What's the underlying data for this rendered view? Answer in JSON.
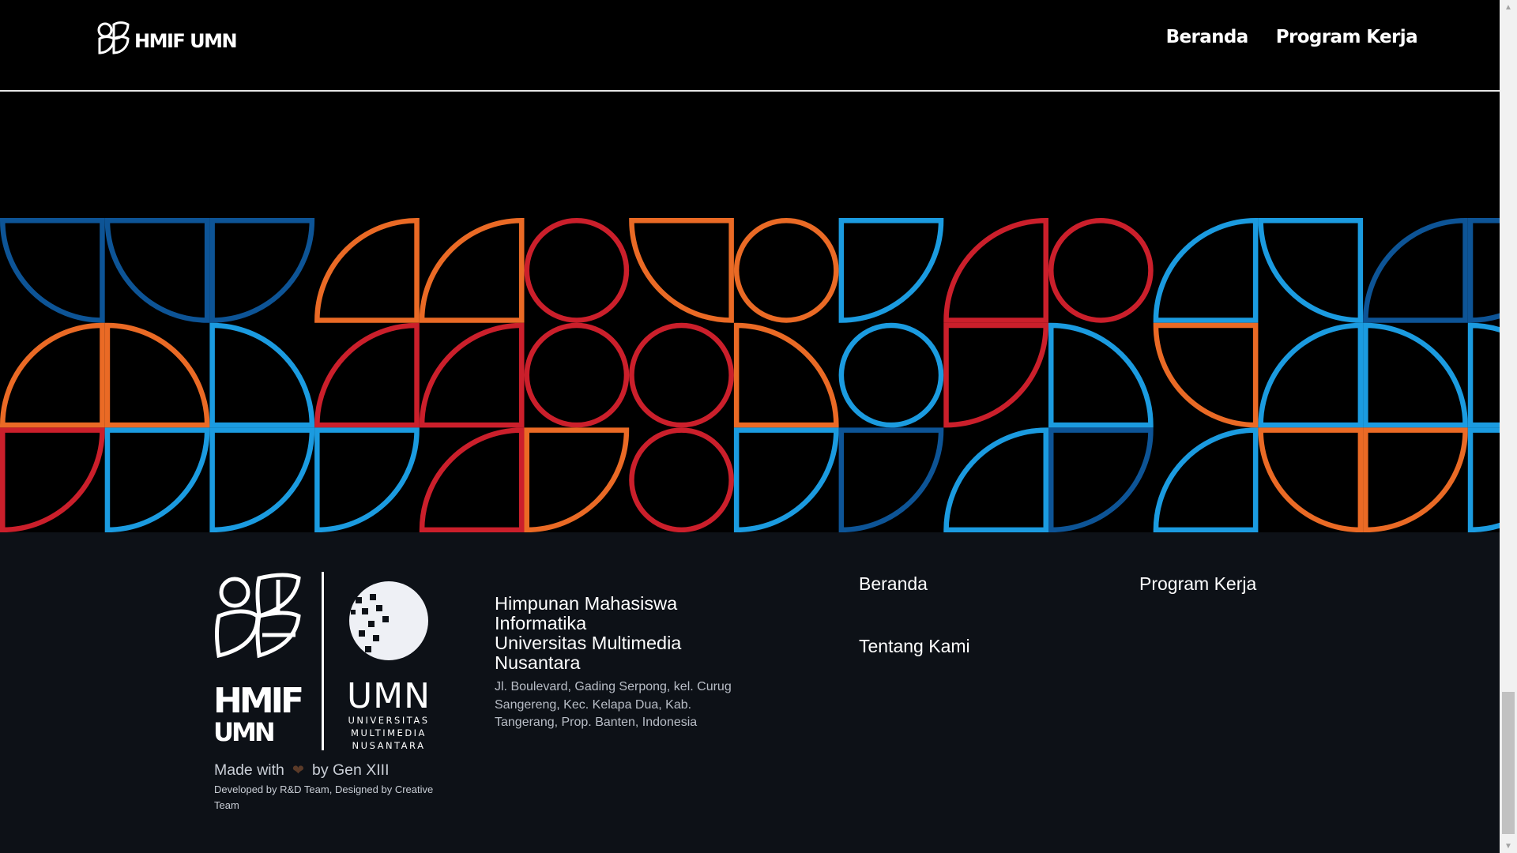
{
  "navbar": {
    "brand_text": "HMIF UMN",
    "links": [
      "Beranda",
      "Program Kerja"
    ]
  },
  "pattern": {
    "colors": {
      "dark_blue": "#0d5496",
      "light_blue": "#1b9be0",
      "orange": "#ea6a25",
      "red": "#cb1f2b"
    }
  },
  "footer": {
    "logo_hmif_text": [
      "HMIF",
      "UMN"
    ],
    "logo_umn_text": "UMN",
    "logo_umn_sub": [
      "UNIVERSITAS",
      "MULTIMEDIA",
      "NUSANTARA"
    ],
    "made_with_prefix": "Made with",
    "made_with_suffix": "by Gen XIII",
    "heart_icon": "heart-icon",
    "credits": "Developed by R&D Team, Designed by Creative Team",
    "org_name_lines": [
      "Himpunan Mahasiswa",
      "Informatika",
      "Universitas Multimedia",
      "Nusantara"
    ],
    "address": "Jl. Boulevard, Gading Serpong, kel. Curug Sangereng, Kec. Kelapa Dua, Kab. Tangerang, Prop. Banten, Indonesia",
    "links": {
      "beranda": "Beranda",
      "program_kerja": "Program Kerja",
      "tentang_kami": "Tentang Kami"
    }
  }
}
